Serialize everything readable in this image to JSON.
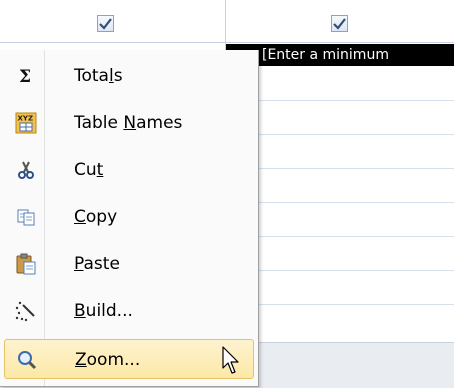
{
  "grid": {
    "highlighted_cell_text": "[Enter a minimum"
  },
  "menu": {
    "items": [
      {
        "label_pre": "Tota",
        "label_accel": "l",
        "label_post": "s",
        "icon": "sigma-icon"
      },
      {
        "label_pre": "Table ",
        "label_accel": "N",
        "label_post": "ames",
        "icon": "table-names-icon"
      },
      {
        "label_pre": "Cu",
        "label_accel": "t",
        "label_post": "",
        "icon": "scissors-icon"
      },
      {
        "label_pre": "",
        "label_accel": "C",
        "label_post": "opy",
        "icon": "copy-icon"
      },
      {
        "label_pre": "",
        "label_accel": "P",
        "label_post": "aste",
        "icon": "paste-icon"
      },
      {
        "label_pre": "",
        "label_accel": "B",
        "label_post": "uild...",
        "icon": "build-wand-icon"
      },
      {
        "label_pre": "",
        "label_accel": "Z",
        "label_post": "oom...",
        "icon": "zoom-icon",
        "hovered": true
      }
    ]
  },
  "colors": {
    "hover_bg": "#fce8a6",
    "hover_border": "#e5c365",
    "selected_cell_bg": "#000000"
  }
}
